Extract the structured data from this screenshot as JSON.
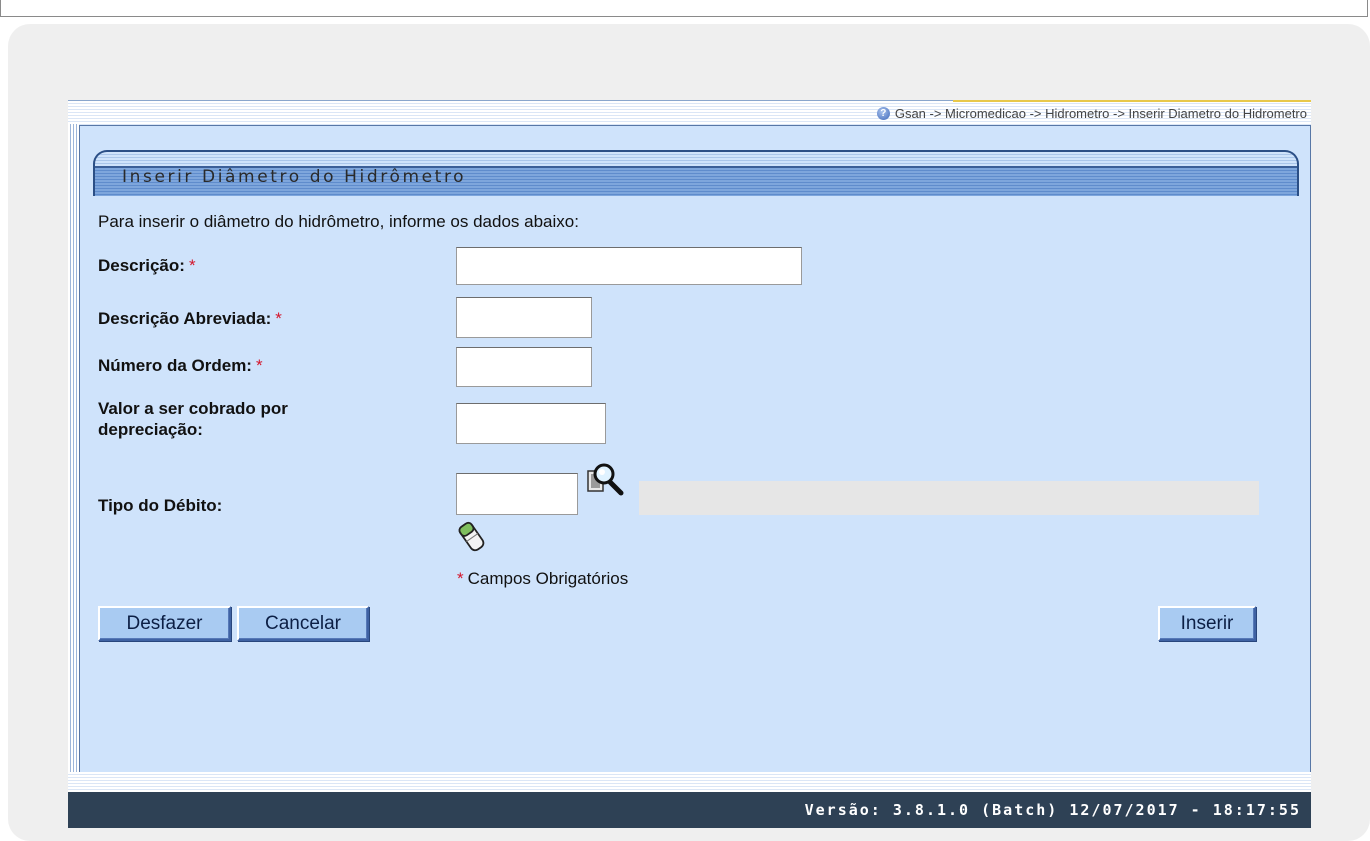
{
  "breadcrumb": "Gsan -> Micromedicao -> Hidrometro -> Inserir Diametro do Hidrometro",
  "page_title": "Inserir Diâmetro do Hidrômetro",
  "intro": "Para inserir o diâmetro do hidrômetro, informe os dados abaixo:",
  "form": {
    "descricao_label": "Descrição:",
    "descricao_abreviada_label": "Descrição Abreviada:",
    "numero_ordem_label": "Número da Ordem:",
    "valor_label_line1": "Valor a ser cobrado por",
    "valor_label_line2": "depreciação:",
    "tipo_debito_label": "Tipo do Débito:",
    "required_marker": "*",
    "required_note": "Campos Obrigatórios",
    "values": {
      "descricao": "",
      "descricao_abreviada": "",
      "numero_ordem": "",
      "valor": "",
      "tipo_debito_code": "",
      "tipo_debito_desc": ""
    }
  },
  "buttons": {
    "desfazer": "Desfazer",
    "cancelar": "Cancelar",
    "inserir": "Inserir"
  },
  "version": "Versão: 3.8.1.0 (Batch) 12/07/2017 - 18:17:55",
  "icons": {
    "help": "help-icon",
    "lookup": "magnifier-lookup-icon",
    "clear": "eraser-icon"
  },
  "colors": {
    "content_bg": "#cfe3fb",
    "footer_bg": "#2e4155",
    "required": "#d4152b",
    "button_bg": "#a9cbf2"
  }
}
